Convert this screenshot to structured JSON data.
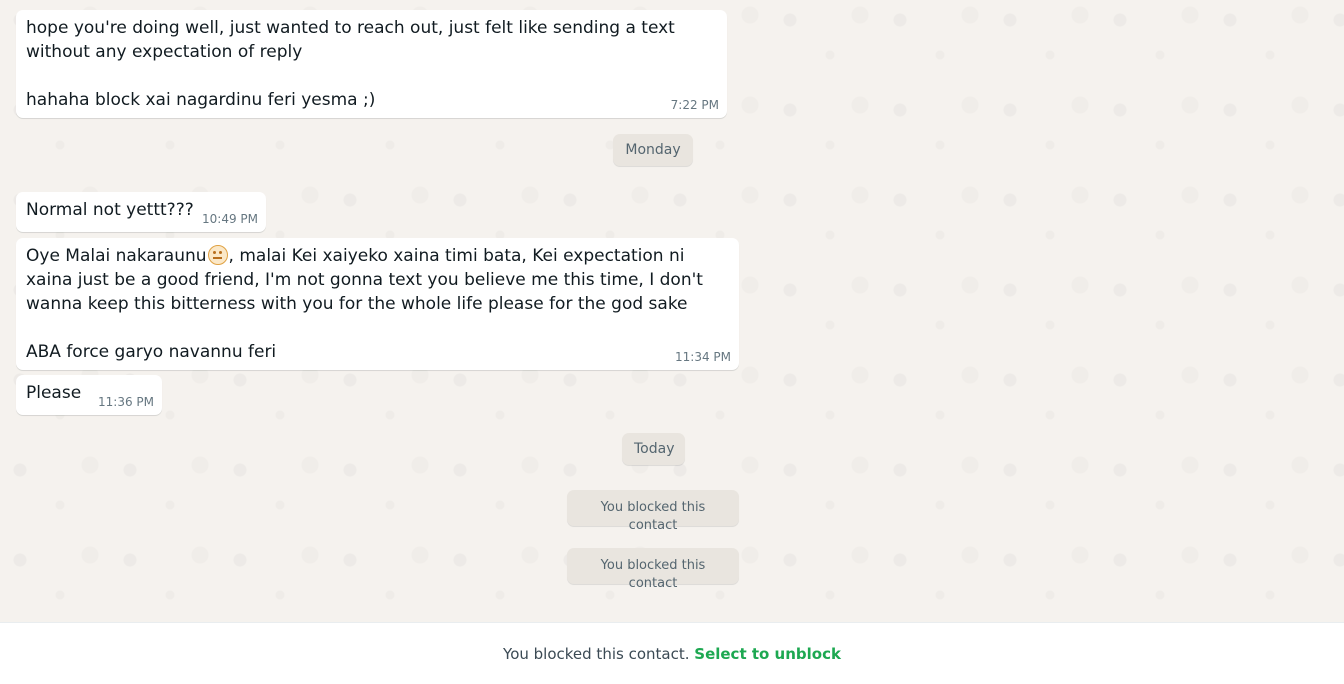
{
  "messages": [
    {
      "text": "hope you're doing well, just wanted to reach out, just felt like sending a text without any expectation of reply\n\nhahaha block xai nagardinu feri yesma ;)",
      "time": "7:22 PM"
    },
    {
      "text": "Normal not yettt???",
      "time": "10:49 PM"
    },
    {
      "text_before_emoji": "Oye Malai nakaraunu",
      "emoji": "neutral-face",
      "text_after_emoji": ", malai Kei xaiyeko xaina timi bata, Kei expectation ni xaina just be a good friend, I'm not gonna text you believe me this time, I don't wanna keep this bitterness with you for the whole life please for the god sake\n\nABA force garyo navannu feri",
      "time": "11:34 PM"
    },
    {
      "text": "Please",
      "time": "11:36 PM"
    }
  ],
  "date_labels": {
    "monday": "Monday",
    "today": "Today"
  },
  "system_messages": [
    "You blocked this contact",
    "You blocked this contact"
  ],
  "footer": {
    "blocked_text": "You blocked this contact.",
    "unblock_label": "Select to unblock",
    "unblock_color": "#1da851"
  }
}
